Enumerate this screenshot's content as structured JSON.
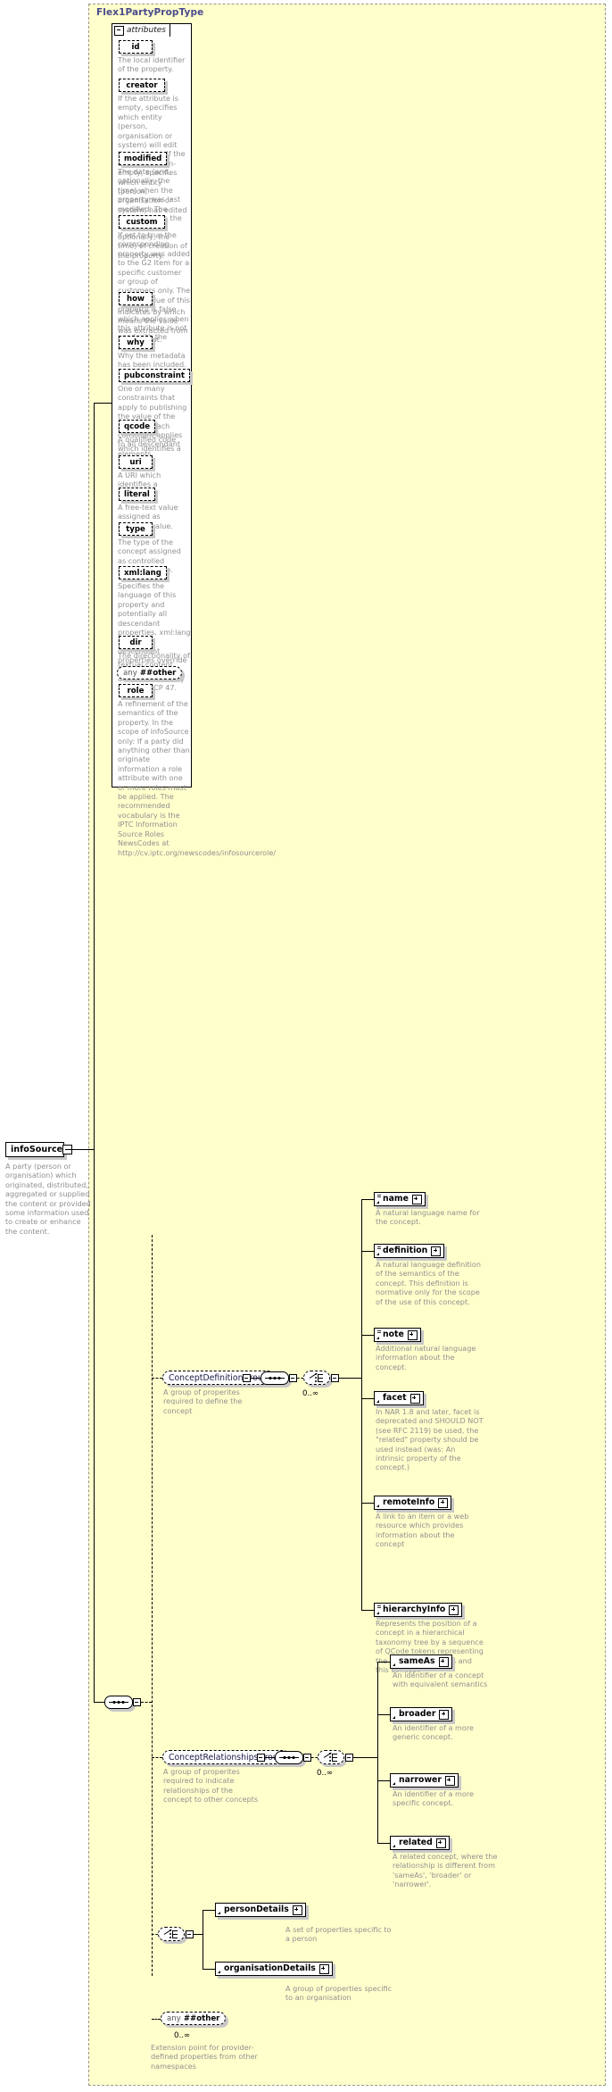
{
  "diagram": {
    "type_title": "Flex1PartyPropType",
    "root_element": {
      "label": "infoSource",
      "doc": "A party (person or organisation) which originated, distributed, aggregated or supplied the content or provided some information used to create or enhance the content."
    },
    "attributes_tab": "attributes",
    "attributes": [
      {
        "name": "id",
        "doc": "The local identifier of the property."
      },
      {
        "name": "creator",
        "doc": "If the attribute is empty, specifies which entity (person, organisation or system) will edit the property. If the attribute is non-empty, specifies which entity (person, organisation or system) has edited the property."
      },
      {
        "name": "modified",
        "doc": "The date (and, optionally, the time) when the property was last modified. The initial value is the date (and, optionally, the time) of creation of the property."
      },
      {
        "name": "custom",
        "doc": "If set to true the corresponding property was added to the G2 Item for a specific customer or group of customers only. The default value of this property is false which applies when this attribute is not used with the property."
      },
      {
        "name": "how",
        "doc": "Indicates by which means the value was extracted from the content."
      },
      {
        "name": "why",
        "doc": "Why the metadata has been included."
      },
      {
        "name": "pubconstraint",
        "doc": "One or many constraints that apply to publishing the value of the property. Each constraint applies to all descendant elements."
      },
      {
        "name": "qcode",
        "doc": "A qualified code which identifies a concept."
      },
      {
        "name": "uri",
        "doc": "A URI which identifies a concept."
      },
      {
        "name": "literal",
        "doc": "A free-text value assigned as property value."
      },
      {
        "name": "type",
        "doc": "The type of the concept assigned as controlled property value."
      },
      {
        "name": "xml:lang",
        "doc": "Specifies the language of this property and potentially all descendant properties. xml:lang values of descendant properties override this value. Values are determined by Internet BCP 47."
      },
      {
        "name": "dir",
        "doc": "The directionality of textual content."
      }
    ],
    "attribute_any": {
      "any_label": "any",
      "namespace_label": "##other"
    },
    "attributes_after_any": [
      {
        "name": "role",
        "doc": "A refinement of the semantics of the property. In the scope of infoSource only: If a party did anything other than originate information a role attribute with one or more roles must be applied. The recommended vocabulary is the IPTC Information Source Roles NewsCodes at http://cv.iptc.org/newscodes/infosourcerole/"
      }
    ],
    "groups": [
      {
        "name": "ConceptDefinitionGroup",
        "doc": "A group of properites required to define the concept",
        "occurs": "0..∞",
        "elements": [
          {
            "name": "name",
            "doc": "A natural language name for the concept."
          },
          {
            "name": "definition",
            "doc": "A natural language definition of the semantics of the concept. This definition is normative only for the scope of the use of this concept."
          },
          {
            "name": "note",
            "doc": "Additional natural language information about the concept."
          },
          {
            "name": "facet",
            "doc": "In NAR 1.8 and later, facet is deprecated and SHOULD NOT (see RFC 2119) be used, the \"related\" property should be used instead (was: An intrinsic property of the concept.)"
          },
          {
            "name": "remoteInfo",
            "doc": "A link to an item or a web resource which provides information about the concept"
          },
          {
            "name": "hierarchyInfo",
            "doc": "Represents the position of a concept in a hierarchical taxonomy tree by a sequence of QCode tokens representing the ancestor concepts and this concept"
          }
        ]
      },
      {
        "name": "ConceptRelationshipsGroup",
        "doc": "A group of properites required to indicate relationships of the concept to other concepts",
        "occurs": "0..∞",
        "elements": [
          {
            "name": "sameAs",
            "doc": "An identifier of a concept with equivalent semantics"
          },
          {
            "name": "broader",
            "doc": "An identifier of a more generic concept."
          },
          {
            "name": "narrower",
            "doc": "An identifier of a more specific concept."
          },
          {
            "name": "related",
            "doc": "A related concept, where the relationship is different from 'sameAs', 'broader' or 'narrower'."
          }
        ]
      }
    ],
    "detail_choice": {
      "elements": [
        {
          "name": "personDetails",
          "doc": "A set of properties specific to a person"
        },
        {
          "name": "organisationDetails",
          "doc": "A group of properties specific to an organisation"
        }
      ]
    },
    "element_any": {
      "any_label": "any",
      "namespace_label": "##other",
      "occurs": "0..∞",
      "doc": "Extension point for provider-defined properties from other namespaces"
    },
    "colors": {
      "container_fill": "#ffffcc",
      "container_border": "#969696",
      "title": "#4a4a8c",
      "doc_text": "#909090",
      "box_shadow": "#c8c8c8"
    }
  }
}
